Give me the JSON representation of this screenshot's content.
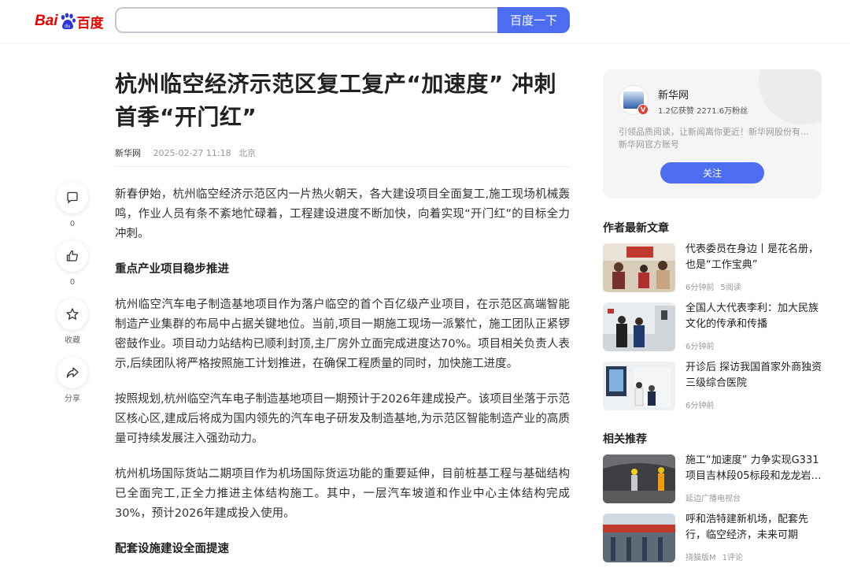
{
  "header": {
    "logo_left": "Bai",
    "logo_right": "百度",
    "search_value": "",
    "search_button": "百度一下"
  },
  "article": {
    "title": "杭州临空经济示范区复工复产“加速度” 冲刺首季“开门红”",
    "source": "新华网",
    "time": "2025-02-27 11:18",
    "location": "北京",
    "p1": "新春伊始，杭州临空经济示范区内一片热火朝天，各大建设项目全面复工,施工现场机械轰鸣，作业人员有条不紊地忙碌着，工程建设进度不断加快，向着实现“开门红”的目标全力冲刺。",
    "h1": "重点产业项目稳步推进",
    "p2": "杭州临空汽车电子制造基地项目作为落户临空的首个百亿级产业项目，在示范区高端智能制造产业集群的布局中占据关键地位。当前,项目一期施工现场一派繁忙，施工团队正紧锣密鼓作业。项目动力站结构已顺利封顶,主厂房外立面完成进度达70%。项目相关负责人表示,后续团队将严格按照施工计划推进，在确保工程质量的同时，加快施工进度。",
    "p3": "按照规划,杭州临空汽车电子制造基地项目一期预计于2026年建成投产。该项目坐落于示范区核心区,建成后将成为国内领先的汽车电子研发及制造基地,为示范区智能制造产业的高质量可持续发展注入强劲动力。",
    "p4": "杭州机场国际货站二期项目作为机场国际货运功能的重要延伸，目前桩基工程与基础结构已全面完工,正全力推进主体结构施工。其中，一层汽车坡道和作业中心主体结构完成30%，预计2026年建成投入使用。",
    "h2": "配套设施建设全面提速"
  },
  "actions": {
    "comment_count": "0",
    "like_count": "0",
    "favorite_label": "收藏",
    "share_label": "分享"
  },
  "author": {
    "name": "新华网",
    "badge": "V",
    "stats": "1.2亿获赞 2271.6万粉丝",
    "desc_line1": "引领品质阅读，让新闻离你更近！新华网股份有...",
    "desc_line2": "新华网官方账号",
    "follow": "关注"
  },
  "latest": {
    "heading": "作者最新文章",
    "items": [
      {
        "title": "代表委员在身边丨是花名册，也是“工作宝典”",
        "time": "6分钟前",
        "reads": "5阅读"
      },
      {
        "title": "全国人大代表李利：加大民族文化的传承和传播",
        "time": "6分钟前",
        "reads": ""
      },
      {
        "title": "开诊后 探访我国首家外商独资三级综合医院",
        "time": "6分钟前",
        "reads": ""
      }
    ]
  },
  "related": {
    "heading": "相关推荐",
    "items": [
      {
        "title": "施工“加速度” 力争实现G331项目吉林段05标段和龙龙岩…",
        "source": "延边广播电视台",
        "extra": ""
      },
      {
        "title": "呼和浩特建新机场，配套先行，临空经济，未来可期",
        "source": "挠猫版M",
        "extra": "1评论"
      }
    ]
  },
  "colors": {
    "brand_red": "#e10601",
    "accent_blue": "#4e6ef2"
  }
}
